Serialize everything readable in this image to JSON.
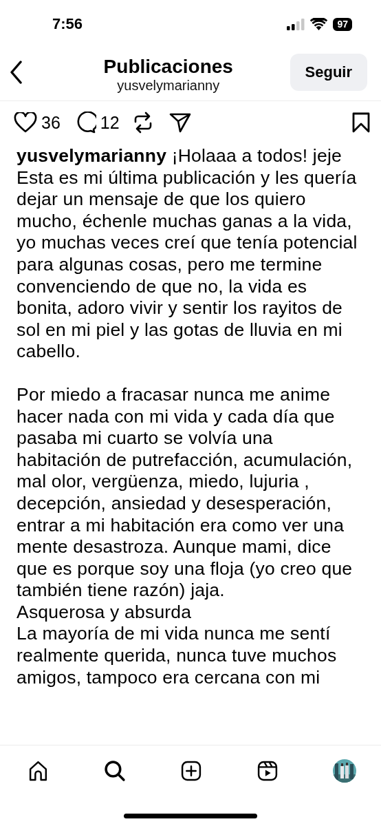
{
  "status_bar": {
    "time": "7:56",
    "battery": "97"
  },
  "header": {
    "title": "Publicaciones",
    "subtitle": "yusvelymarianny",
    "follow_button": "Seguir"
  },
  "actions": {
    "likes": "36",
    "comments": "12"
  },
  "caption": {
    "paragraphs": [
      "**yusvelymarianny** ¡Holaaa a todos! jeje\nEsta es mi última publicación y les quería\ndejar un mensaje de que los quiero\nmucho, échenle muchas ganas a la vida,\nyo muchas veces creí que tenía potencial\npara algunas cosas, pero me termine\nconvenciendo de que no, la vida es\nbonita, adoro vivir y sentir los rayitos de\nsol en mi piel y las gotas de lluvia en mi\ncabello.",
      "Por miedo a fracasar nunca me anime\nhacer nada con mi vida y cada día que\npasaba mi cuarto se volvía una\nhabitación de putrefacción, acumulación,\nmal olor, vergüenza, miedo, lujuria ,\ndecepción, ansiedad y desesperación,\nentrar a mi habitación era como ver una\nmente desastroza. Aunque mami, dice\nque es porque soy una floja (yo creo que\ntambién tiene razón) jaja.\nAsquerosa y absurda\nLa mayoría de mi vida nunca me sentí\nrealmente querida, nunca tuve muchos\namigos, tampoco era cercana con mi"
    ]
  },
  "tab_bar": [
    {
      "kind": "home",
      "selected": false
    },
    {
      "kind": "search",
      "selected": true
    },
    {
      "kind": "create",
      "selected": false
    },
    {
      "kind": "reels",
      "selected": false
    },
    {
      "kind": "profile",
      "selected": false
    }
  ]
}
